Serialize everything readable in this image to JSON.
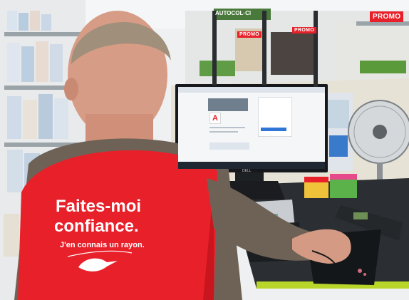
{
  "scene": {
    "store_signs": {
      "promo_labels": [
        "PROMO",
        "PROMO",
        "PROMO"
      ],
      "top_sign": "AUTOCOL·Cl"
    },
    "vest": {
      "line1": "Faites-moi",
      "line2": "confiance.",
      "tagline": "J'en connais un rayon."
    },
    "monitor_brand": "DELL",
    "colors": {
      "vest_red": "#e8202a",
      "promo_red": "#e8202a",
      "shelf_white": "#f2f2f2",
      "floor": "#e7e2d6"
    }
  }
}
